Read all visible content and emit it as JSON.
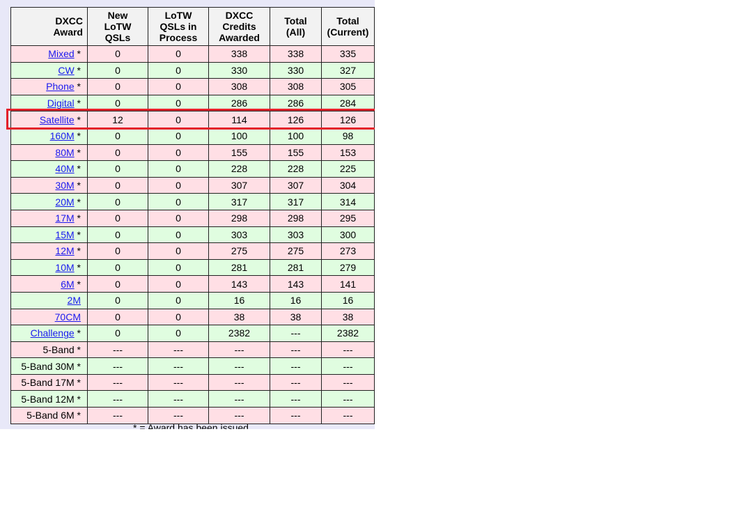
{
  "headers": {
    "award": [
      "DXCC",
      "Award"
    ],
    "new_lotw": [
      "New",
      "LoTW",
      "QSLs"
    ],
    "in_process": [
      "LoTW",
      "QSLs in",
      "Process"
    ],
    "credits": [
      "DXCC",
      "Credits",
      "Awarded"
    ],
    "total_all": [
      "Total",
      "(All)"
    ],
    "total_current": [
      "Total",
      "(Current)"
    ]
  },
  "rows": [
    {
      "award": "Mixed",
      "link": true,
      "issued": " *",
      "new": "0",
      "process": "0",
      "credits": "338",
      "all": "338",
      "current": "335",
      "tone": "pink"
    },
    {
      "award": "CW",
      "link": true,
      "issued": " *",
      "new": "0",
      "process": "0",
      "credits": "330",
      "all": "330",
      "current": "327",
      "tone": "green"
    },
    {
      "award": "Phone",
      "link": true,
      "issued": " *",
      "new": "0",
      "process": "0",
      "credits": "308",
      "all": "308",
      "current": "305",
      "tone": "pink"
    },
    {
      "award": "Digital",
      "link": true,
      "issued": " *",
      "new": "0",
      "process": "0",
      "credits": "286",
      "all": "286",
      "current": "284",
      "tone": "green"
    },
    {
      "award": "Satellite",
      "link": true,
      "issued": " *",
      "new": "12",
      "process": "0",
      "credits": "114",
      "all": "126",
      "current": "126",
      "tone": "pink"
    },
    {
      "award": "160M",
      "link": true,
      "issued": " *",
      "new": "0",
      "process": "0",
      "credits": "100",
      "all": "100",
      "current": "98",
      "tone": "green"
    },
    {
      "award": "80M",
      "link": true,
      "issued": " *",
      "new": "0",
      "process": "0",
      "credits": "155",
      "all": "155",
      "current": "153",
      "tone": "pink"
    },
    {
      "award": "40M",
      "link": true,
      "issued": " *",
      "new": "0",
      "process": "0",
      "credits": "228",
      "all": "228",
      "current": "225",
      "tone": "green"
    },
    {
      "award": "30M",
      "link": true,
      "issued": " *",
      "new": "0",
      "process": "0",
      "credits": "307",
      "all": "307",
      "current": "304",
      "tone": "pink"
    },
    {
      "award": "20M",
      "link": true,
      "issued": " *",
      "new": "0",
      "process": "0",
      "credits": "317",
      "all": "317",
      "current": "314",
      "tone": "green"
    },
    {
      "award": "17M",
      "link": true,
      "issued": " *",
      "new": "0",
      "process": "0",
      "credits": "298",
      "all": "298",
      "current": "295",
      "tone": "pink"
    },
    {
      "award": "15M",
      "link": true,
      "issued": " *",
      "new": "0",
      "process": "0",
      "credits": "303",
      "all": "303",
      "current": "300",
      "tone": "green"
    },
    {
      "award": "12M",
      "link": true,
      "issued": " *",
      "new": "0",
      "process": "0",
      "credits": "275",
      "all": "275",
      "current": "273",
      "tone": "pink"
    },
    {
      "award": "10M",
      "link": true,
      "issued": " *",
      "new": "0",
      "process": "0",
      "credits": "281",
      "all": "281",
      "current": "279",
      "tone": "green"
    },
    {
      "award": "6M",
      "link": true,
      "issued": " *",
      "new": "0",
      "process": "0",
      "credits": "143",
      "all": "143",
      "current": "141",
      "tone": "pink"
    },
    {
      "award": "2M",
      "link": true,
      "issued": "",
      "new": "0",
      "process": "0",
      "credits": "16",
      "all": "16",
      "current": "16",
      "tone": "green"
    },
    {
      "award": "70CM",
      "link": true,
      "issued": "",
      "new": "0",
      "process": "0",
      "credits": "38",
      "all": "38",
      "current": "38",
      "tone": "pink"
    },
    {
      "award": "Challenge",
      "link": true,
      "issued": " *",
      "new": "0",
      "process": "0",
      "credits": "2382",
      "all": "---",
      "current": "2382",
      "tone": "green"
    },
    {
      "award": "5-Band",
      "link": false,
      "issued": " *",
      "new": "---",
      "process": "---",
      "credits": "---",
      "all": "---",
      "current": "---",
      "tone": "pink"
    },
    {
      "award": "5-Band 30M",
      "link": false,
      "issued": " *",
      "new": "---",
      "process": "---",
      "credits": "---",
      "all": "---",
      "current": "---",
      "tone": "green"
    },
    {
      "award": "5-Band 17M",
      "link": false,
      "issued": " *",
      "new": "---",
      "process": "---",
      "credits": "---",
      "all": "---",
      "current": "---",
      "tone": "pink"
    },
    {
      "award": "5-Band 12M",
      "link": false,
      "issued": " *",
      "new": "---",
      "process": "---",
      "credits": "---",
      "all": "---",
      "current": "---",
      "tone": "green"
    },
    {
      "award": "5-Band 6M",
      "link": false,
      "issued": " *",
      "new": "---",
      "process": "---",
      "credits": "---",
      "all": "---",
      "current": "---",
      "tone": "pink"
    }
  ],
  "highlight": {
    "row_award": "Satellite",
    "color": "#e4202a"
  },
  "colors": {
    "pink_row": "#ffdfe5",
    "green_row": "#e0fde0",
    "link": "#1a1aee",
    "page_bg": "#e8e8f8"
  },
  "footnote": "* = Award has been issued"
}
